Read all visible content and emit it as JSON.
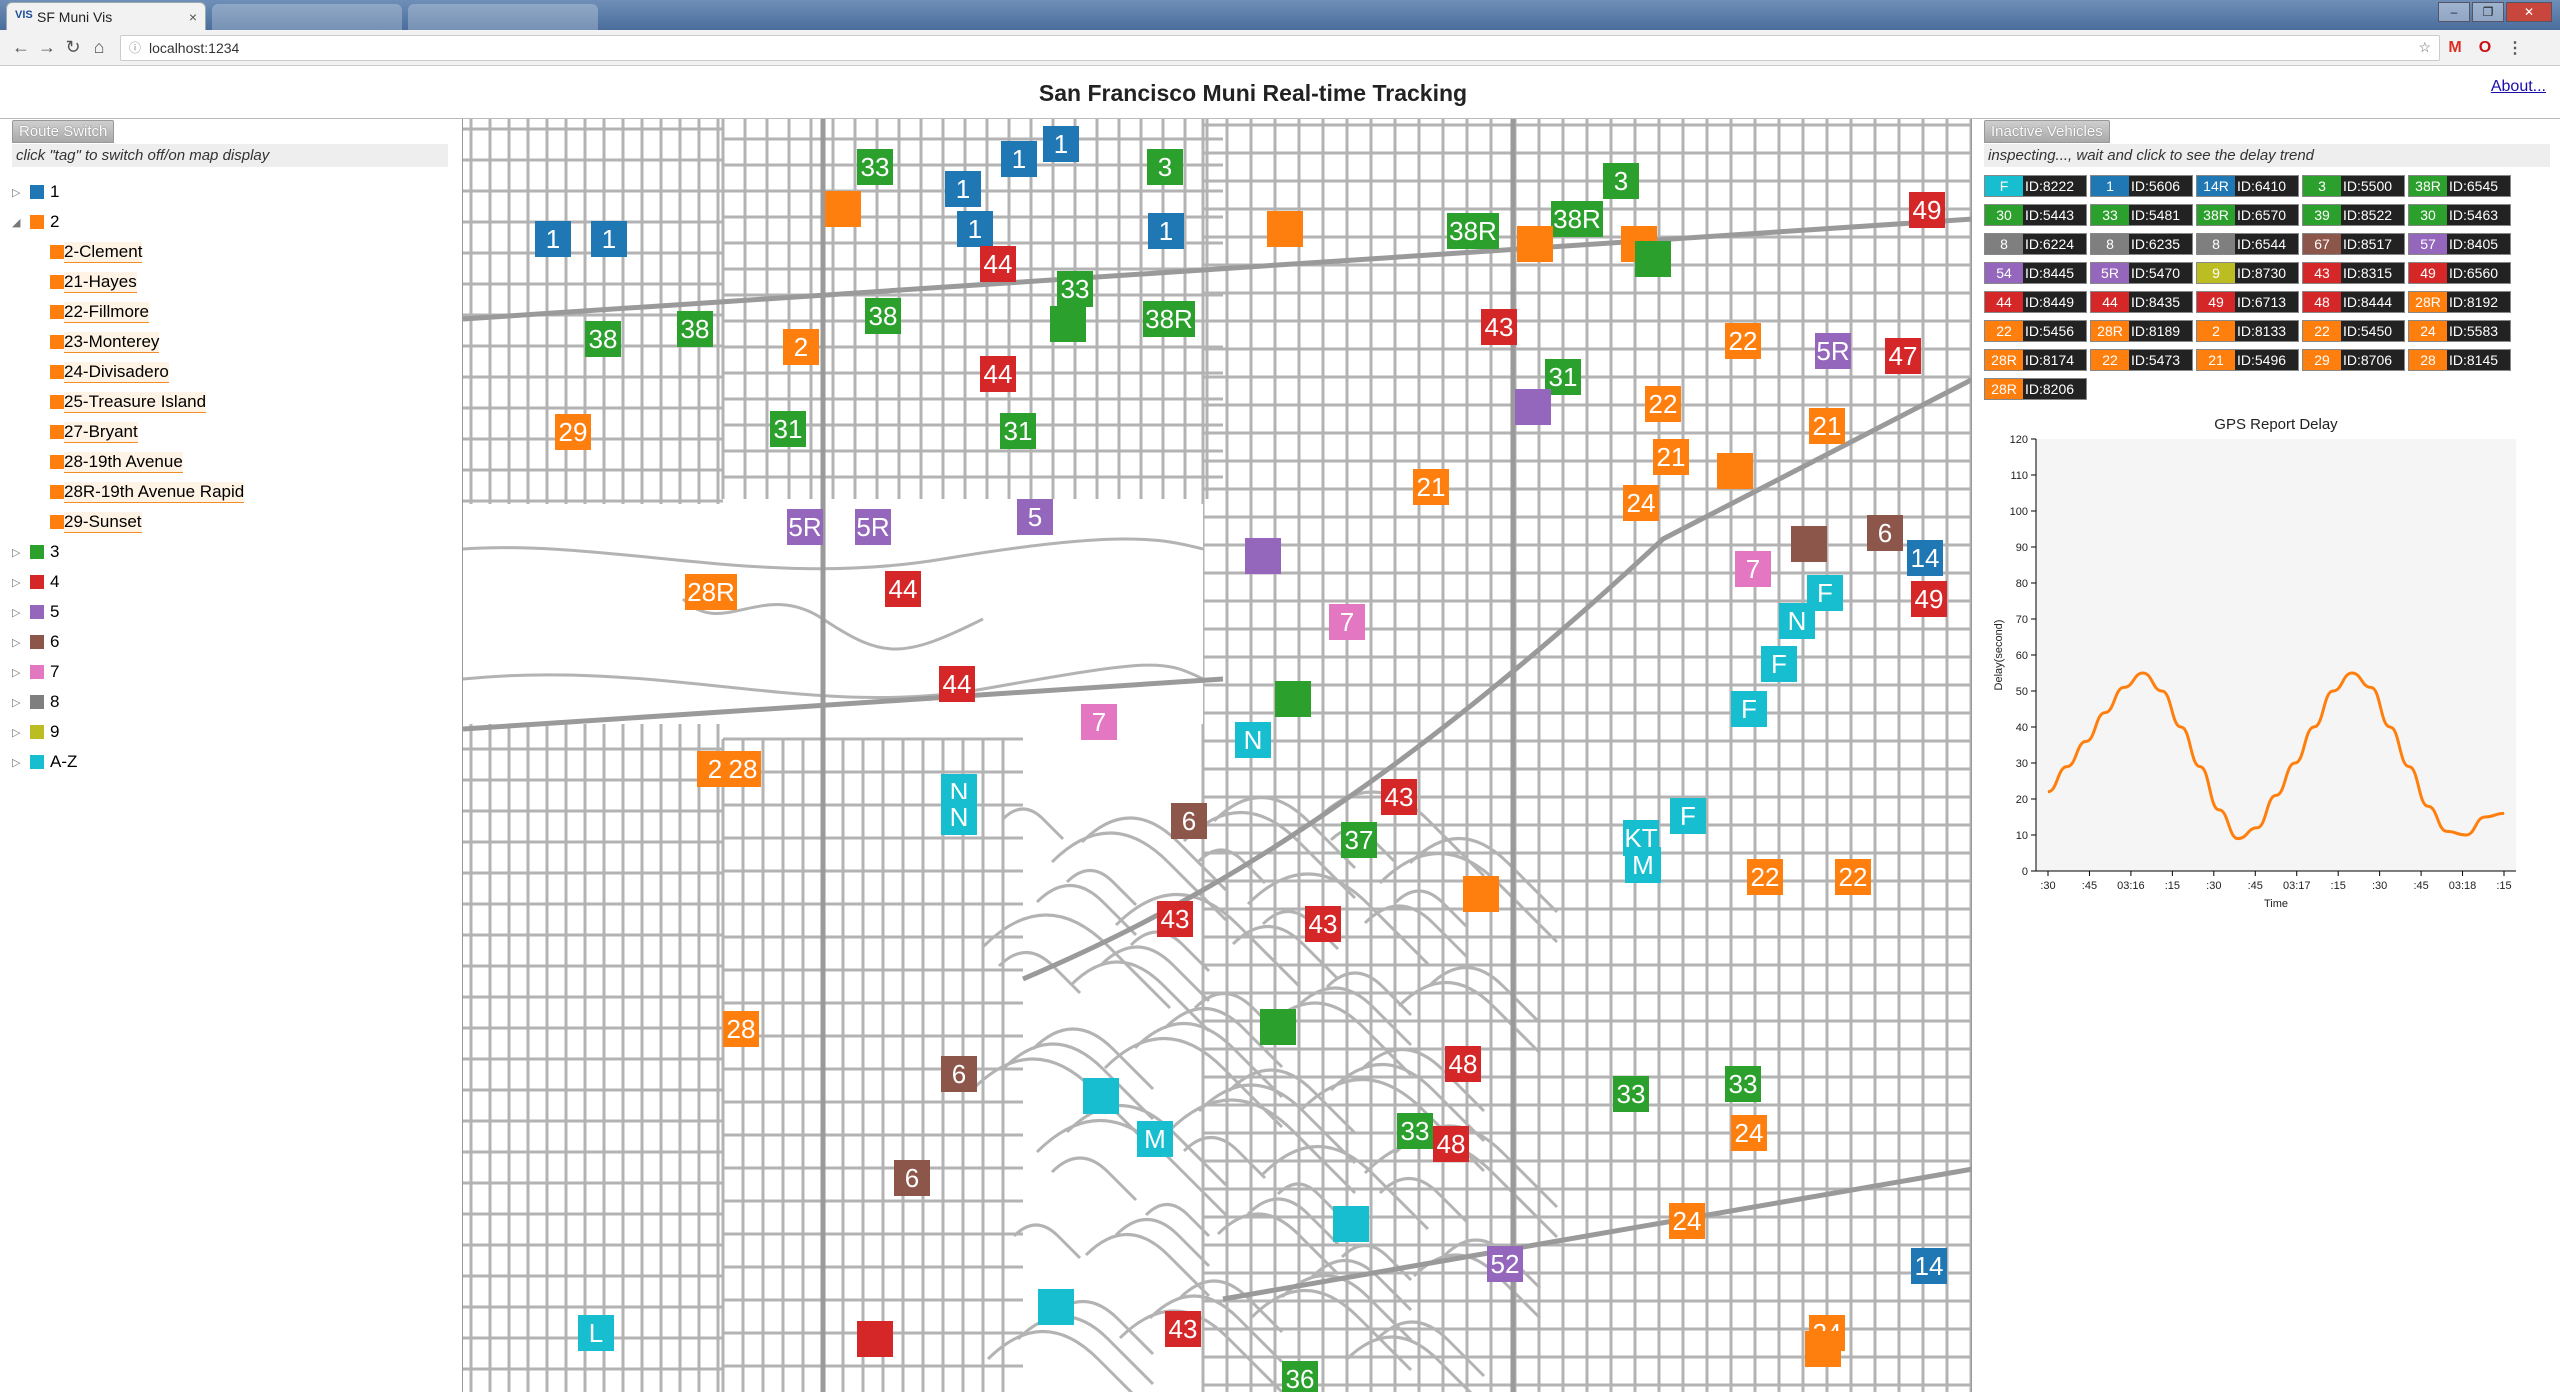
{
  "browser": {
    "tab_title": "SF Muni Vis",
    "tab_icon": "VIS",
    "address": "localhost:1234",
    "tab_close": "×"
  },
  "page": {
    "title": "San Francisco Muni Real-time Tracking",
    "about": "About..."
  },
  "left_panel": {
    "button": "Route Switch",
    "hint": "click \"tag\" to switch off/on map display",
    "routes": [
      {
        "label": "1",
        "color": "#1f77b4",
        "expanded": false
      },
      {
        "label": "2",
        "color": "#ff7f0e",
        "expanded": true
      },
      {
        "label": "3",
        "color": "#2ca02c",
        "expanded": false
      },
      {
        "label": "4",
        "color": "#d62728",
        "expanded": false
      },
      {
        "label": "5",
        "color": "#9467bd",
        "expanded": false
      },
      {
        "label": "6",
        "color": "#8c564b",
        "expanded": false
      },
      {
        "label": "7",
        "color": "#e377c2",
        "expanded": false
      },
      {
        "label": "8",
        "color": "#7f7f7f",
        "expanded": false
      },
      {
        "label": "9",
        "color": "#bcbd22",
        "expanded": false
      },
      {
        "label": "A-Z",
        "color": "#17becf",
        "expanded": false
      }
    ],
    "subroutes": [
      "2-Clement",
      "21-Hayes",
      "22-Fillmore",
      "23-Monterey",
      "24-Divisadero",
      "25-Treasure Island",
      "27-Bryant",
      "28-19th Avenue",
      "28R-19th Avenue Rapid",
      "29-Sunset"
    ]
  },
  "map": {
    "markers": [
      {
        "label": "1",
        "color": "#1f77b4"
      },
      {
        "label": "33",
        "color": "#2ca02c"
      },
      {
        "label": "3",
        "color": "#2ca02c"
      },
      {
        "label": "38R",
        "color": "#2ca02c"
      },
      {
        "label": "2",
        "color": "#ff7f0e"
      },
      {
        "label": "44",
        "color": "#d62728"
      },
      {
        "label": "38",
        "color": "#2ca02c"
      },
      {
        "label": "43",
        "color": "#d62728"
      },
      {
        "label": "31",
        "color": "#2ca02c"
      },
      {
        "label": "29",
        "color": "#ff7f0e"
      },
      {
        "label": "22",
        "color": "#ff7f0e"
      },
      {
        "label": "47",
        "color": "#d62728"
      },
      {
        "label": "49",
        "color": "#d62728"
      },
      {
        "label": "5R",
        "color": "#9467bd"
      },
      {
        "label": "5",
        "color": "#9467bd"
      },
      {
        "label": "21",
        "color": "#ff7f0e"
      },
      {
        "label": "24",
        "color": "#ff7f0e"
      },
      {
        "label": "28R",
        "color": "#ff7f0e"
      },
      {
        "label": "7",
        "color": "#e377c2"
      },
      {
        "label": "N",
        "color": "#17becf"
      },
      {
        "label": "F",
        "color": "#17becf"
      },
      {
        "label": "28",
        "color": "#ff7f0e"
      },
      {
        "label": "37",
        "color": "#2ca02c"
      },
      {
        "label": "M",
        "color": "#17becf"
      },
      {
        "label": "KT",
        "color": "#17becf"
      },
      {
        "label": "6",
        "color": "#8c564b"
      },
      {
        "label": "48",
        "color": "#d62728"
      },
      {
        "label": "52",
        "color": "#9467bd"
      },
      {
        "label": "L",
        "color": "#17becf"
      },
      {
        "label": "14",
        "color": "#1f77b4"
      },
      {
        "label": "36",
        "color": "#2ca02c"
      }
    ]
  },
  "right_panel": {
    "button": "Inactive Vehicles",
    "hint": "inspecting..., wait and click to see the delay trend",
    "vehicles": [
      {
        "tag": "F",
        "id": "ID:8222",
        "color": "#17becf"
      },
      {
        "tag": "1",
        "id": "ID:5606",
        "color": "#1f77b4"
      },
      {
        "tag": "14R",
        "id": "ID:6410",
        "color": "#1f77b4"
      },
      {
        "tag": "3",
        "id": "ID:5500",
        "color": "#2ca02c"
      },
      {
        "tag": "38R",
        "id": "ID:6545",
        "color": "#2ca02c"
      },
      {
        "tag": "30",
        "id": "ID:5443",
        "color": "#2ca02c"
      },
      {
        "tag": "33",
        "id": "ID:5481",
        "color": "#2ca02c"
      },
      {
        "tag": "38R",
        "id": "ID:6570",
        "color": "#2ca02c"
      },
      {
        "tag": "39",
        "id": "ID:8522",
        "color": "#2ca02c"
      },
      {
        "tag": "30",
        "id": "ID:5463",
        "color": "#2ca02c"
      },
      {
        "tag": "8",
        "id": "ID:6224",
        "color": "#7f7f7f"
      },
      {
        "tag": "8",
        "id": "ID:6235",
        "color": "#7f7f7f"
      },
      {
        "tag": "8",
        "id": "ID:6544",
        "color": "#7f7f7f"
      },
      {
        "tag": "67",
        "id": "ID:8517",
        "color": "#8c564b"
      },
      {
        "tag": "57",
        "id": "ID:8405",
        "color": "#9467bd"
      },
      {
        "tag": "54",
        "id": "ID:8445",
        "color": "#9467bd"
      },
      {
        "tag": "5R",
        "id": "ID:5470",
        "color": "#9467bd"
      },
      {
        "tag": "9",
        "id": "ID:8730",
        "color": "#bcbd22"
      },
      {
        "tag": "43",
        "id": "ID:8315",
        "color": "#d62728"
      },
      {
        "tag": "49",
        "id": "ID:6560",
        "color": "#d62728"
      },
      {
        "tag": "44",
        "id": "ID:8449",
        "color": "#d62728"
      },
      {
        "tag": "44",
        "id": "ID:8435",
        "color": "#d62728"
      },
      {
        "tag": "49",
        "id": "ID:6713",
        "color": "#d62728"
      },
      {
        "tag": "48",
        "id": "ID:8444",
        "color": "#d62728"
      },
      {
        "tag": "28R",
        "id": "ID:8192",
        "color": "#ff7f0e"
      },
      {
        "tag": "22",
        "id": "ID:5456",
        "color": "#ff7f0e"
      },
      {
        "tag": "28R",
        "id": "ID:8189",
        "color": "#ff7f0e"
      },
      {
        "tag": "2",
        "id": "ID:8133",
        "color": "#ff7f0e"
      },
      {
        "tag": "22",
        "id": "ID:5450",
        "color": "#ff7f0e"
      },
      {
        "tag": "24",
        "id": "ID:5583",
        "color": "#ff7f0e"
      },
      {
        "tag": "28R",
        "id": "ID:8174",
        "color": "#ff7f0e"
      },
      {
        "tag": "22",
        "id": "ID:5473",
        "color": "#ff7f0e"
      },
      {
        "tag": "21",
        "id": "ID:5496",
        "color": "#ff7f0e"
      },
      {
        "tag": "29",
        "id": "ID:8706",
        "color": "#ff7f0e"
      },
      {
        "tag": "28",
        "id": "ID:8145",
        "color": "#ff7f0e"
      },
      {
        "tag": "28R",
        "id": "ID:8206",
        "color": "#ff7f0e"
      }
    ]
  },
  "chart_data": {
    "type": "line",
    "title": "GPS Report Delay",
    "xlabel": "Time",
    "ylabel": "Delay(second)",
    "ylim": [
      0,
      120
    ],
    "yticks": [
      0,
      10,
      20,
      30,
      40,
      50,
      60,
      70,
      80,
      90,
      100,
      110,
      120
    ],
    "xticks": [
      ":30",
      ":45",
      "03:16",
      ":15",
      ":30",
      ":45",
      "03:17",
      ":15",
      ":30",
      ":45",
      "03:18",
      ":15"
    ],
    "grid": false,
    "series": [
      {
        "color": "#ff7f0e",
        "x": [
          0,
          0.5,
          1,
          1.5,
          2,
          2.5,
          3,
          3.5,
          4,
          4.5,
          5,
          5.5,
          6,
          6.5,
          7,
          7.5,
          8,
          8.5,
          9,
          9.5,
          10,
          10.5,
          11,
          11.5,
          12
        ],
        "y": [
          22,
          29,
          36,
          44,
          51,
          55,
          50,
          40,
          29,
          17,
          9,
          12,
          21,
          30,
          40,
          50,
          55,
          51,
          40,
          29,
          18,
          11,
          10,
          15,
          16
        ]
      }
    ]
  }
}
